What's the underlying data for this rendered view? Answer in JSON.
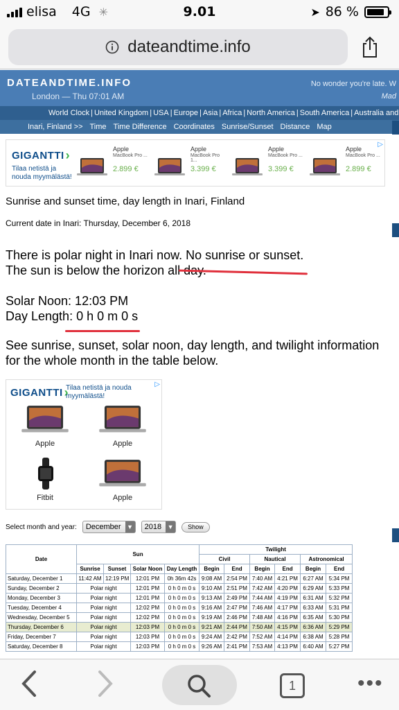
{
  "status": {
    "carrier": "elisa",
    "network": "4G",
    "time": "9.01",
    "battery": "86 %",
    "battery_level": 0.86
  },
  "browser": {
    "url": "dateandtime.info"
  },
  "header": {
    "logo": "DATEANDTIME.INFO",
    "clock": "London — Thu 07:01 AM",
    "tagline": "No wonder you're late. W",
    "tagline2": "Mad"
  },
  "nav_regions": [
    "World Clock",
    "|",
    "United Kingdom",
    "|",
    "USA",
    "|",
    "Europe",
    "|",
    "Asia",
    "|",
    "Africa",
    "|",
    "North America",
    "|",
    "South America",
    "|",
    "Australia and O"
  ],
  "nav_tabs": [
    "Inari, Finland >>",
    "Time",
    "Time Difference",
    "Coordinates",
    "Sunrise/Sunset",
    "Distance",
    "Map"
  ],
  "ad_top": {
    "brand": "GIGANTTI",
    "slogan": "Tilaa netistä ja nouda myymälästä!",
    "products": [
      {
        "title": "Apple",
        "subtitle": "MacBook Pro ...",
        "price": "2.899 €"
      },
      {
        "title": "Apple",
        "subtitle": "MacBook Pro 1...",
        "price": "3.399 €"
      },
      {
        "title": "Apple",
        "subtitle": "MacBook Pro ...",
        "price": "3.399 €"
      },
      {
        "title": "Apple",
        "subtitle": "MacBook Pro ...",
        "price": "2.899 €"
      }
    ]
  },
  "main": {
    "heading": "Sunrise and sunset time, day length in Inari, Finland",
    "current_date": "Current date in Inari: Thursday, December 6, 2018",
    "polar_line1": "There is polar night in Inari now. No sunrise or sunset.",
    "polar_line2": "The sun is below the horizon all day.",
    "solar_noon": "Solar Noon: 12:03 PM",
    "day_length": "Day Length: 0 h 0 m 0 s",
    "see_also": "See sunrise, sunset, solar noon, day length, and twilight information for the whole month in the table below."
  },
  "ad_side": {
    "brand": "GIGANTTI",
    "slogan": "Tilaa netistä ja nouda myymälästä!",
    "tiles": [
      "Apple",
      "Apple",
      "Fitbit",
      "Apple"
    ]
  },
  "selector": {
    "label": "Select month and year:",
    "month": "December",
    "year": "2018",
    "show": "Show"
  },
  "table": {
    "h_date": "Date",
    "h_sun": "Sun",
    "h_twilight": "Twilight",
    "h_civil": "Civil",
    "h_nautical": "Nautical",
    "h_astro": "Astronomical",
    "sub": [
      "Sunrise",
      "Sunset",
      "Solar Noon",
      "Day Length",
      "Begin",
      "End",
      "Begin",
      "End",
      "Begin",
      "End"
    ],
    "rows": [
      [
        "Saturday, December 1",
        "11:42 AM",
        "12:19 PM",
        "12:01 PM",
        "0h 36m 42s",
        "9:08 AM",
        "2:54 PM",
        "7:40 AM",
        "4:21 PM",
        "6:27 AM",
        "5:34 PM"
      ],
      [
        "Sunday, December 2",
        "Polar night",
        "",
        "12:01 PM",
        "0 h 0 m 0 s",
        "9:10 AM",
        "2:51 PM",
        "7:42 AM",
        "4:20 PM",
        "6:29 AM",
        "5:33 PM"
      ],
      [
        "Monday, December 3",
        "Polar night",
        "",
        "12:01 PM",
        "0 h 0 m 0 s",
        "9:13 AM",
        "2:49 PM",
        "7:44 AM",
        "4:19 PM",
        "6:31 AM",
        "5:32 PM"
      ],
      [
        "Tuesday, December 4",
        "Polar night",
        "",
        "12:02 PM",
        "0 h 0 m 0 s",
        "9:16 AM",
        "2:47 PM",
        "7:46 AM",
        "4:17 PM",
        "6:33 AM",
        "5:31 PM"
      ],
      [
        "Wednesday, December 5",
        "Polar night",
        "",
        "12:02 PM",
        "0 h 0 m 0 s",
        "9:19 AM",
        "2:46 PM",
        "7:48 AM",
        "4:16 PM",
        "6:35 AM",
        "5:30 PM"
      ],
      [
        "Thursday, December 6",
        "Polar night",
        "",
        "12:03 PM",
        "0 h 0 m 0 s",
        "9:21 AM",
        "2:44 PM",
        "7:50 AM",
        "4:15 PM",
        "6:36 AM",
        "5:29 PM"
      ],
      [
        "Friday, December 7",
        "Polar night",
        "",
        "12:03 PM",
        "0 h 0 m 0 s",
        "9:24 AM",
        "2:42 PM",
        "7:52 AM",
        "4:14 PM",
        "6:38 AM",
        "5:28 PM"
      ],
      [
        "Saturday, December 8",
        "Polar night",
        "",
        "12:03 PM",
        "0 h 0 m 0 s",
        "9:26 AM",
        "2:41 PM",
        "7:53 AM",
        "4:13 PM",
        "6:40 AM",
        "5:27 PM"
      ]
    ]
  },
  "toolbar": {
    "tabs_count": "1"
  },
  "colors": {
    "banner": "#4a7db5",
    "nav": "#2f5f8f",
    "highlight_row": "#e8ecd0",
    "annotation": "#e0303c",
    "price": "#6ab04c"
  }
}
